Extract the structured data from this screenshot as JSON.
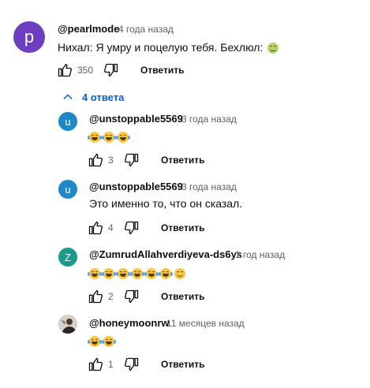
{
  "top_comment": {
    "avatar_letter": "p",
    "avatar_color": "#6b3fc0",
    "username": "@pearlmode",
    "time": "4 года назад",
    "text": "Нихал: Я умру и поцелую тебя. Бехлюл:",
    "emoji": "sick-face",
    "likes": "350",
    "reply_label": "Ответить"
  },
  "replies_toggle": {
    "label": "4 ответа",
    "icon": "chevron-up-icon"
  },
  "replies": [
    {
      "avatar_letter": "u",
      "avatar_color": "#1e88c8",
      "username": "@unstoppable5569",
      "time": "3 года назад",
      "text": "",
      "emojis": [
        "laugh",
        "laugh",
        "laugh"
      ],
      "likes": "3",
      "reply_label": "Ответить"
    },
    {
      "avatar_letter": "u",
      "avatar_color": "#1e88c8",
      "username": "@unstoppable5569",
      "time": "3 года назад",
      "text": "Это именно то, что он сказал.",
      "emojis": [],
      "likes": "4",
      "reply_label": "Ответить"
    },
    {
      "avatar_letter": "Z",
      "avatar_color": "#1a9b8a",
      "username": "@ZumrudAllahverdiyeva-ds6ys",
      "time": "1 год назад",
      "text": "",
      "emojis": [
        "laugh",
        "laugh",
        "laugh",
        "laugh",
        "laugh",
        "laugh",
        "smile"
      ],
      "likes": "2",
      "reply_label": "Ответить"
    },
    {
      "avatar_letter": "",
      "avatar_color": "#b9b9b9",
      "username": "@honeymoonrw",
      "time": "11 месяцев назад",
      "text": "",
      "emojis": [
        "laugh",
        "laugh"
      ],
      "likes": "1",
      "reply_label": "Ответить"
    }
  ]
}
